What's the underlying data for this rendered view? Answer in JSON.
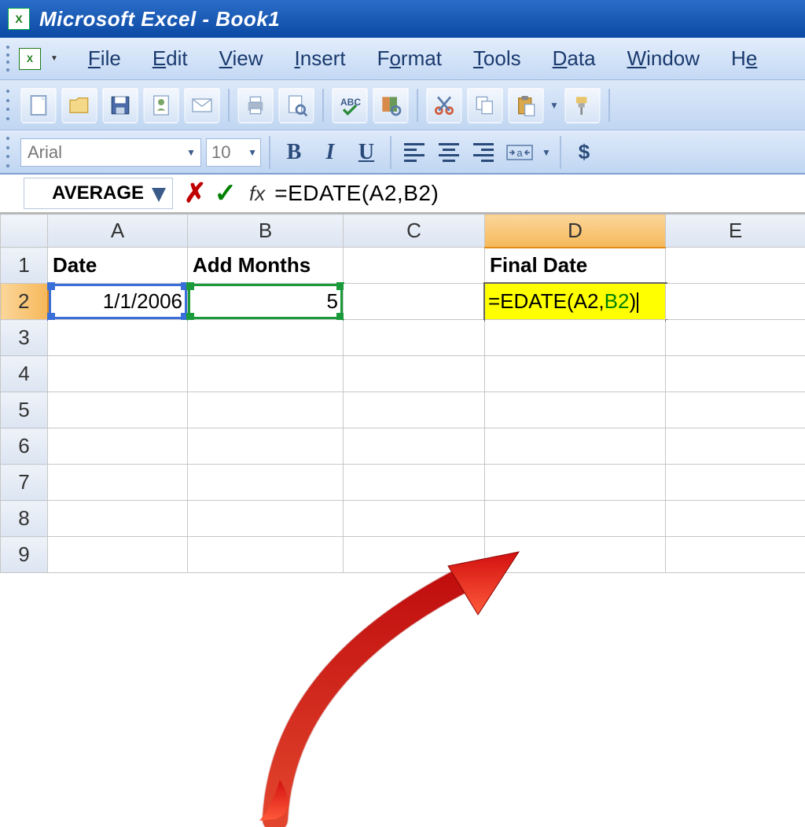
{
  "window": {
    "title": "Microsoft Excel - Book1"
  },
  "menu": {
    "items": [
      {
        "pre": "",
        "key": "F",
        "post": "ile"
      },
      {
        "pre": "",
        "key": "E",
        "post": "dit"
      },
      {
        "pre": "",
        "key": "V",
        "post": "iew"
      },
      {
        "pre": "",
        "key": "I",
        "post": "nsert"
      },
      {
        "pre": "F",
        "key": "o",
        "post": "rmat"
      },
      {
        "pre": "",
        "key": "T",
        "post": "ools"
      },
      {
        "pre": "",
        "key": "D",
        "post": "ata"
      },
      {
        "pre": "",
        "key": "W",
        "post": "indow"
      },
      {
        "pre": "H",
        "key": "e",
        "post": ""
      }
    ]
  },
  "format": {
    "font": "Arial",
    "size": "10",
    "currency": "$"
  },
  "formula_bar": {
    "name_box": "AVERAGE",
    "fx": "fx",
    "formula": "=EDATE(A2,B2)"
  },
  "columns": [
    "A",
    "B",
    "C",
    "D",
    "E"
  ],
  "rows": [
    "1",
    "2",
    "3",
    "4",
    "5",
    "6",
    "7",
    "8",
    "9"
  ],
  "cells": {
    "A1": "Date",
    "B1": "Add Months",
    "D1": "Final Date",
    "A2": "1/1/2006",
    "B2": "5",
    "D2_pre": "=EDATE(A2,",
    "D2_ref": "B2",
    "D2_post": ")"
  },
  "active_col": "D",
  "active_row": "2"
}
